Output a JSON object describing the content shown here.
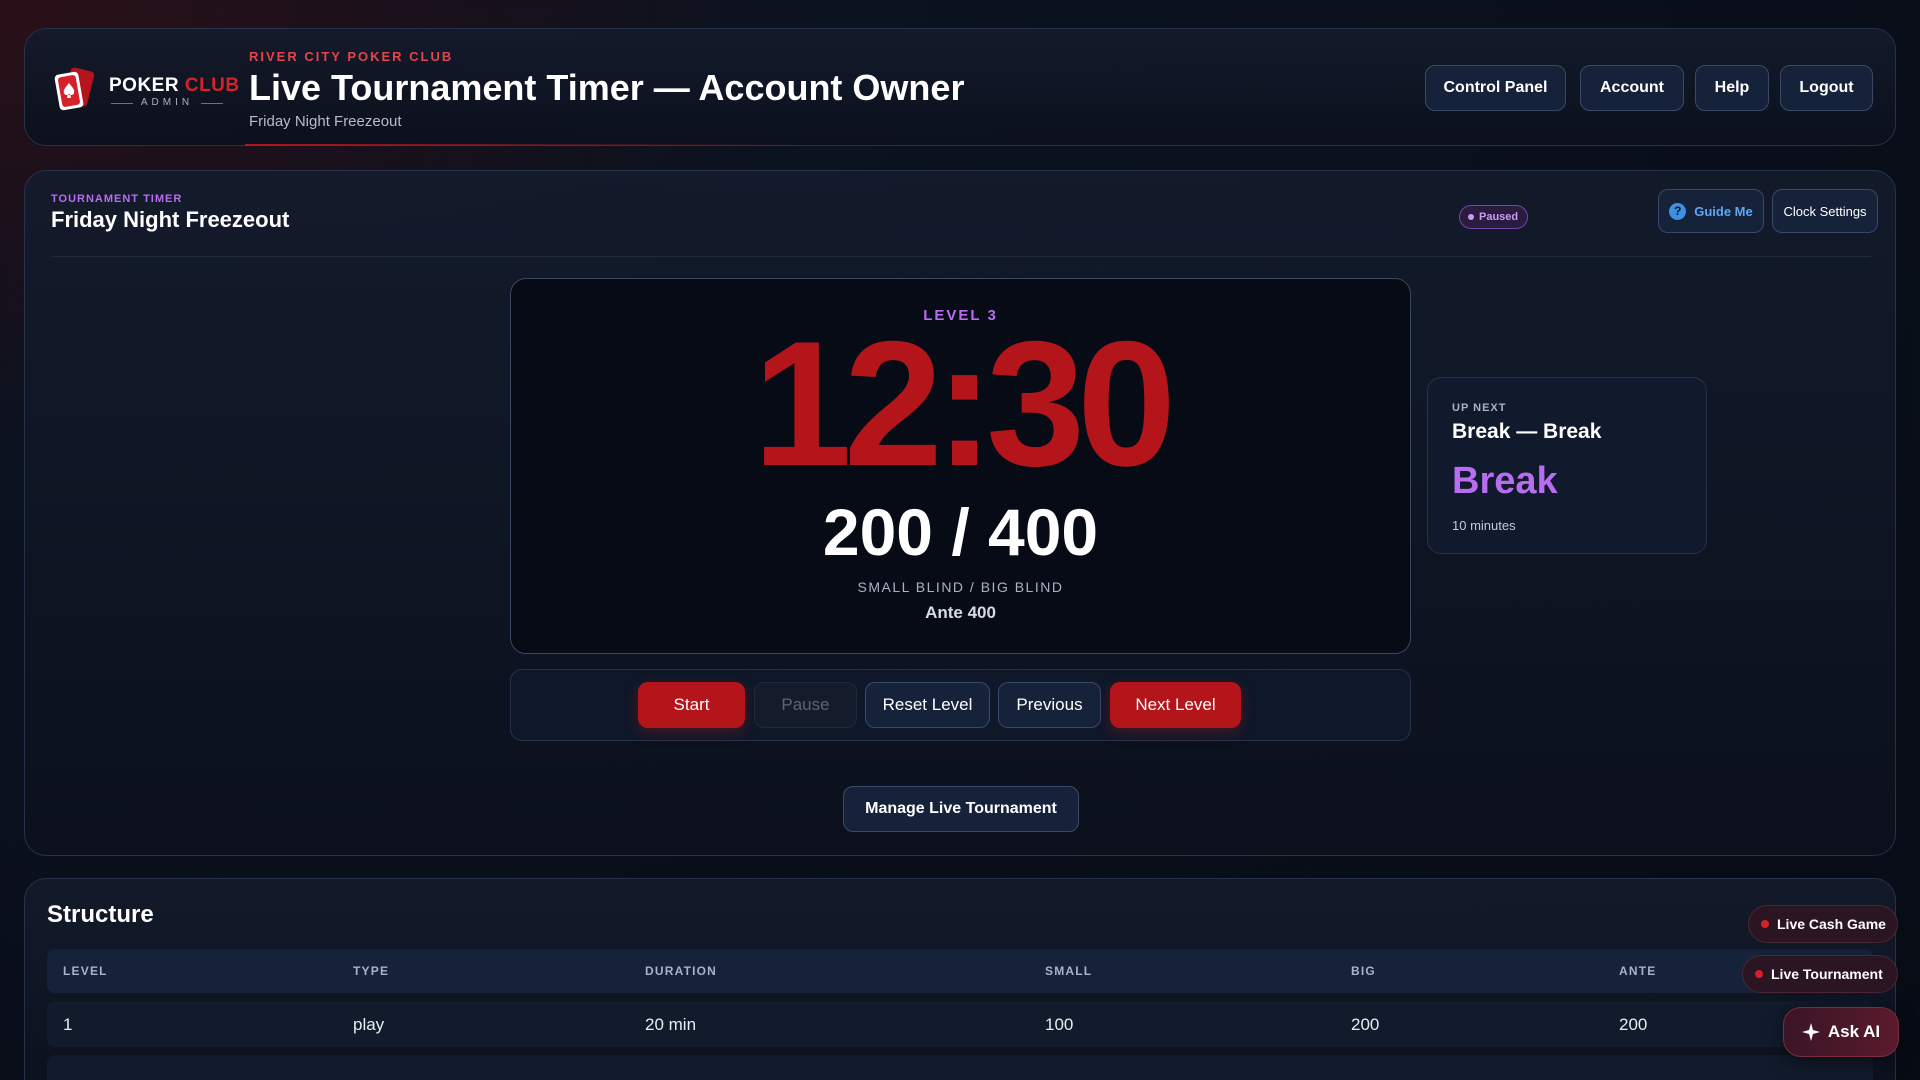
{
  "brand": {
    "logo_main": "POKER",
    "logo_accent": "CLUB",
    "logo_sub": "ADMIN",
    "accent_color": "#b3151b"
  },
  "header": {
    "club_name": "RIVER CITY POKER CLUB",
    "title": "Live Tournament Timer — Account Owner",
    "subtitle": "Friday Night Freezeout",
    "nav": [
      "Control Panel",
      "Account",
      "Help",
      "Logout"
    ]
  },
  "timer": {
    "section_tag": "TOURNAMENT TIMER",
    "tournament_name": "Friday Night Freezeout",
    "status": "Paused",
    "guide_label": "Guide Me",
    "clock_settings_label": "Clock Settings",
    "level_label": "LEVEL 3",
    "time_remaining": "12:30",
    "blinds": "200 / 400",
    "blinds_caption": "SMALL BLIND / BIG BLIND",
    "ante": "Ante 400",
    "controls": {
      "start": "Start",
      "pause": "Pause",
      "reset": "Reset Level",
      "previous": "Previous",
      "next": "Next Level"
    },
    "manage_label": "Manage Live Tournament",
    "up_next": {
      "tag": "UP NEXT",
      "title": "Break — Break",
      "big": "Break",
      "duration": "10 minutes"
    }
  },
  "structure": {
    "title": "Structure",
    "columns": [
      "LEVEL",
      "TYPE",
      "DURATION",
      "SMALL",
      "BIG",
      "ANTE"
    ],
    "rows": [
      [
        "1",
        "play",
        "20 min",
        "100",
        "200",
        "200"
      ]
    ]
  },
  "floating": {
    "live_cash_game": "Live Cash Game",
    "live_tournament": "Live Tournament",
    "ask_ai": "Ask AI"
  }
}
